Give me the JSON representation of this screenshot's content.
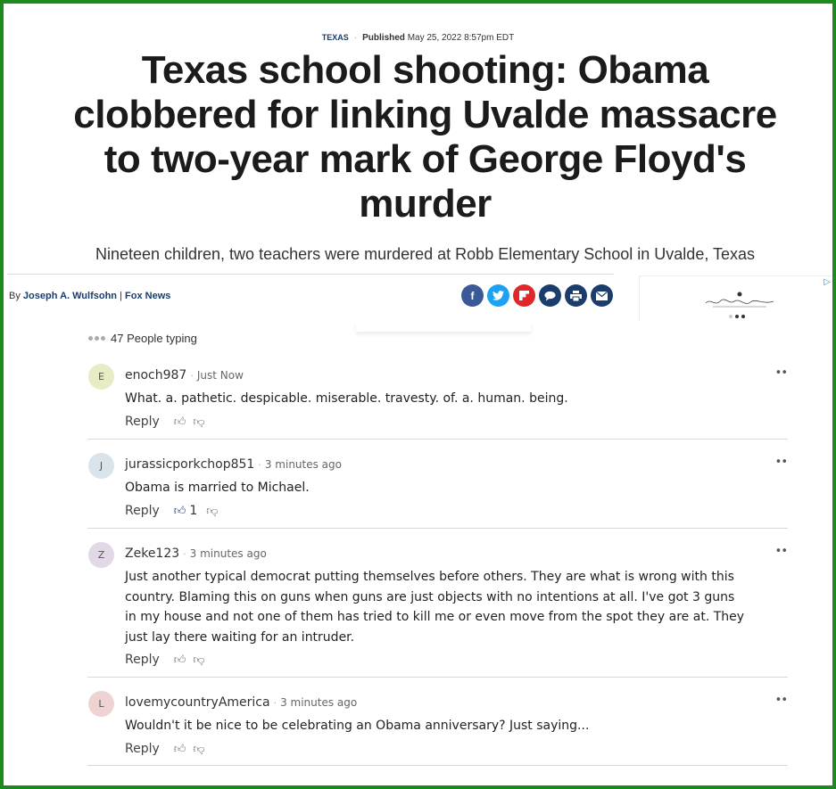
{
  "article": {
    "section": "TEXAS",
    "published_label": "Published",
    "published_date": "May 25, 2022 8:57pm EDT",
    "headline": "Texas school shooting: Obama clobbered for linking Uvalde massacre to two-year mark of George Floyd's murder",
    "subhead": "Nineteen children, two teachers were murdered at Robb Elementary School in Uvalde, Texas",
    "byline_prefix": "By",
    "author": "Joseph A. Wulfsohn",
    "outlet": "Fox News"
  },
  "share_icons": [
    "facebook-icon",
    "twitter-icon",
    "flipboard-icon",
    "comments-icon",
    "print-icon",
    "email-icon"
  ],
  "ad": {
    "adchoices": "▷"
  },
  "typing": {
    "text": "47 People typing"
  },
  "comments": [
    {
      "avatar": "E",
      "user": "enoch987",
      "time": "Just Now",
      "body": "What. a. pathetic. despicable. miserable. travesty. of. a. human. being.",
      "reply": "Reply",
      "likes": ""
    },
    {
      "avatar": "J",
      "user": "jurassicporkchop851",
      "time": "3 minutes ago",
      "body": "Obama is married to Michael.",
      "reply": "Reply",
      "likes": "1"
    },
    {
      "avatar": "Z",
      "user": "Zeke123",
      "time": "3 minutes ago",
      "body": "Just another typical democrat putting themselves before others. They are what is wrong with this country. Blaming this on guns when guns are just objects with no intentions at all. I've got 3 guns in my house and not one of them has tried to kill me or even move from the spot they are at. They just lay there waiting for an intruder.",
      "reply": "Reply",
      "likes": ""
    },
    {
      "avatar": "L",
      "user": "lovemycountryAmerica",
      "time": "3 minutes ago",
      "body": "Wouldn't it be nice to be celebrating an Obama anniversary? Just saying...",
      "reply": "Reply",
      "likes": ""
    }
  ],
  "colors": {
    "frame": "#1e8a1e",
    "brand_blue": "#1a3d6e"
  }
}
